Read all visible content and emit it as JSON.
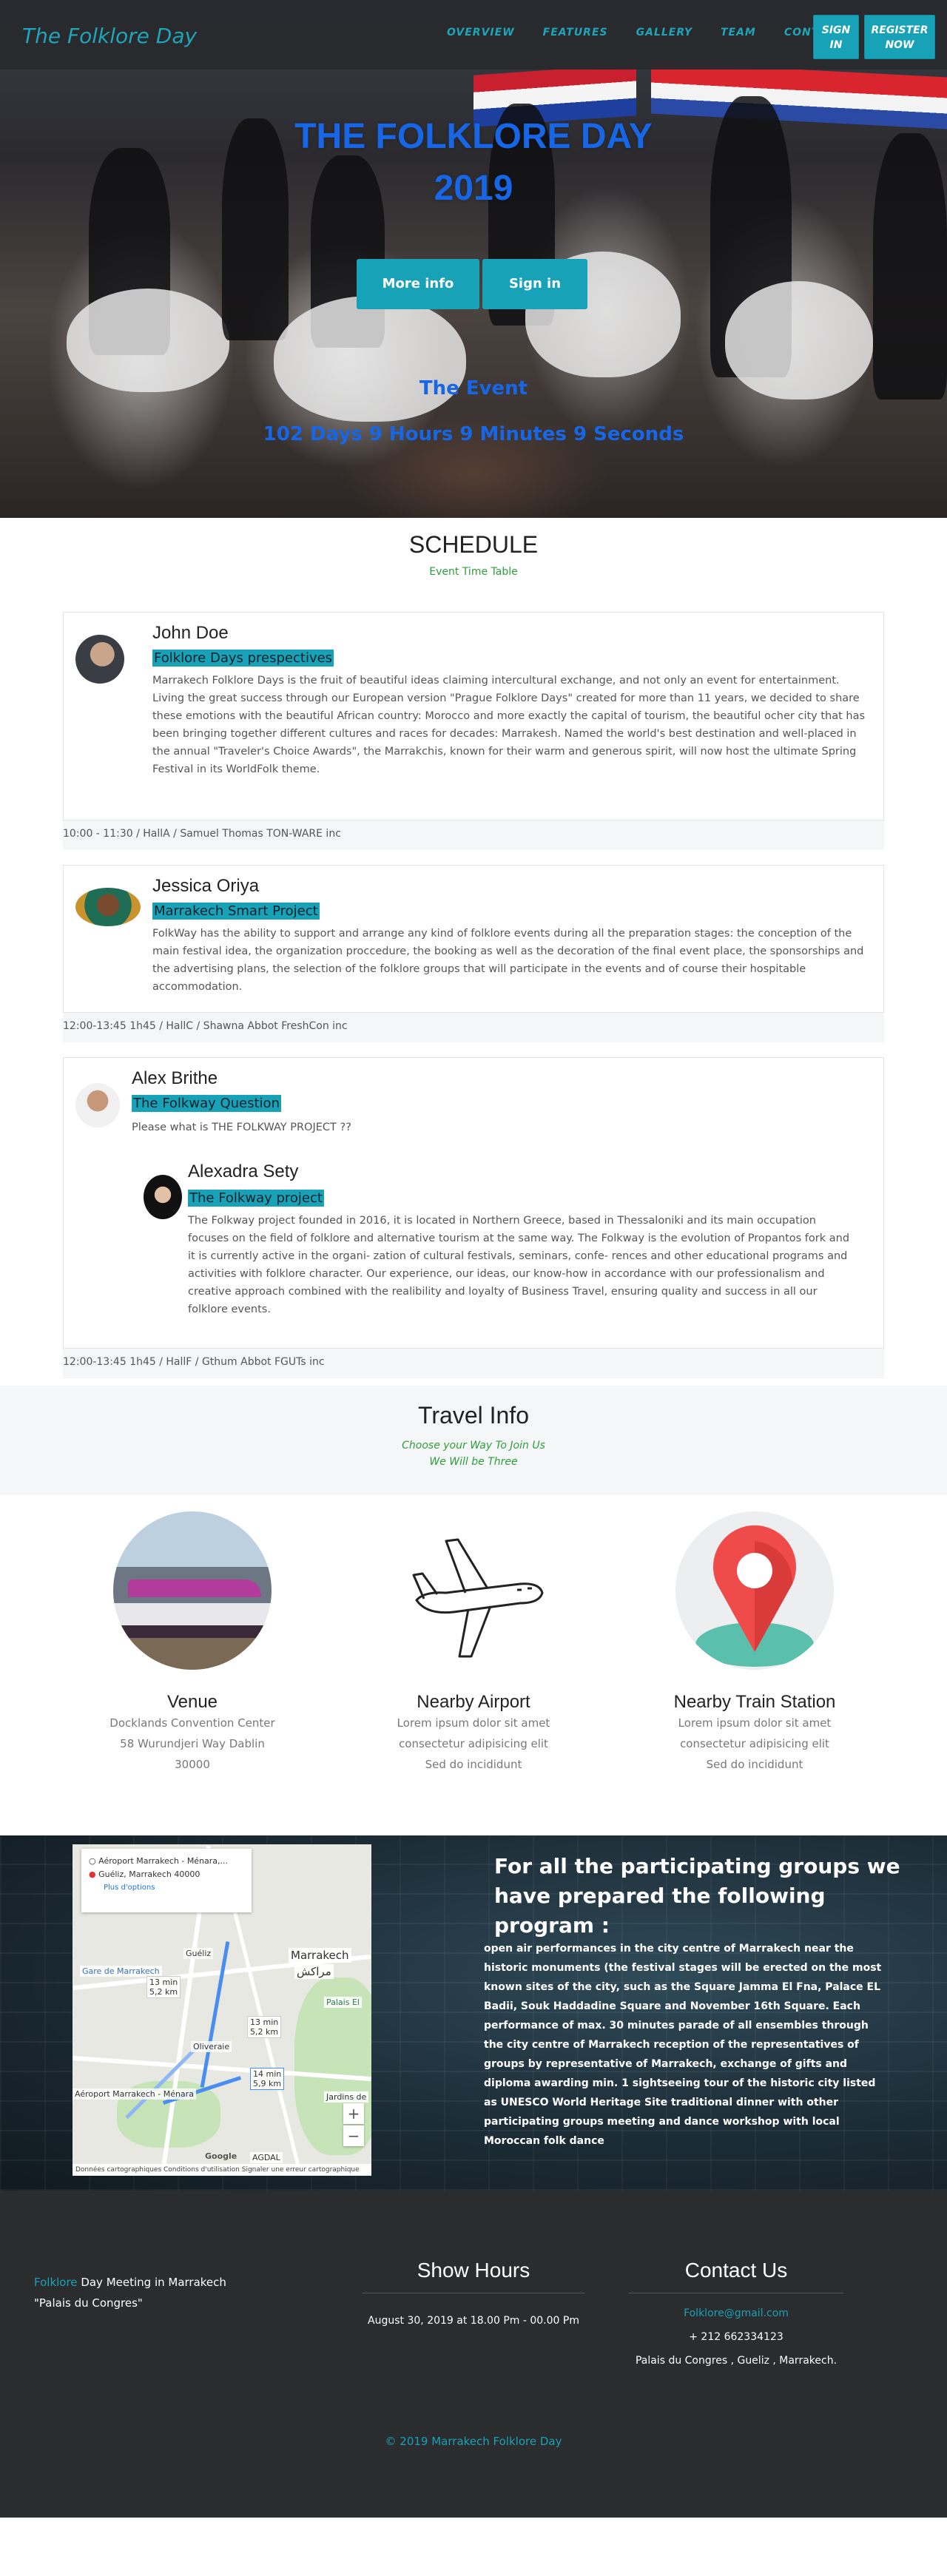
{
  "nav": {
    "brand": "The Folklore Day",
    "links": [
      "OVERVIEW",
      "FEATURES",
      "GALLERY",
      "TEAM",
      "CONTACT"
    ],
    "sign_in": "SIGN IN",
    "register": "REGISTER NOW"
  },
  "hero": {
    "title_line1": "THE FOLKLORE DAY",
    "title_line2": "2019",
    "more_info": "More info",
    "sign_in": "Sign in",
    "event_label": "The Event",
    "countdown": "102 Days 9 Hours 9 Minutes 9 Seconds"
  },
  "schedule": {
    "title": "SCHEDULE",
    "subtitle": "Event Time Table",
    "items": [
      {
        "name": "John Doe",
        "topic": "Folklore Days prespectives",
        "text": "Marrakech Folklore Days is the fruit of beautiful ideas claiming intercultural exchange, and not only an event for entertainment. Living the great success through our European version \"Prague Folklore Days\" created for more than 11 years, we decided to share these emotions with the beautiful African country: Morocco and more exactly the capital of tourism, the beautiful ocher city that has been bringing together different cultures and races for decades: Marrakesh. Named the world's best destination and well-placed in the annual \"Traveler's Choice Awards\", the Marrakchis, known for their warm and generous spirit, will now host the ultimate Spring Festival in its WorldFolk theme.",
        "footer": "10:00 - 11:30 / HallA / Samuel Thomas TON-WARE inc"
      },
      {
        "name": "Jessica Oriya",
        "topic": "Marrakech Smart Project",
        "text": "FolkWay has the ability to support and arrange any kind of folklore events during all the preparation stages: the conception of the main festival idea, the organization proccedure, the booking as well as the decoration of the final event place, the sponsorships and the advertising plans, the selection of the folklore groups that will participate in the events and of course their hospitable accommodation.",
        "footer": "12:00-13:45 1h45 / HallC / Shawna Abbot FreshCon inc"
      },
      {
        "name": "Alex Brithe",
        "topic": "The Folkway Question",
        "text": "Please what is THE FOLKWAY PROJECT ??",
        "reply": {
          "name": "Alexadra Sety",
          "topic": "The Folkway project",
          "text": "The Folkway project founded in 2016, it is located in Northern Greece, based in Thessaloniki and its main occupation focuses on the field of folklore and alternative tourism at the same way. The Folkway is the evolution of Propantos fork and it is currently active in the organi- zation of cultural festivals, seminars, confe- rences and other educational programs and activities with folklore character. Our experience, our ideas, our know-how in accordance with our professionalism and creative approach combined with the realibility and loyalty of Business Travel, ensuring quality and success in all our folklore events."
        },
        "footer": "12:00-13:45 1h45 / HallF / Gthum Abbot FGUTs inc"
      }
    ]
  },
  "travel": {
    "title": "Travel Info",
    "line1": "Choose your Way To Join Us",
    "line2": "We Will be Three",
    "cols": [
      {
        "title": "Venue",
        "lines": [
          "Docklands Convention Center",
          "58 Wurundjeri Way Dablin",
          "30000"
        ]
      },
      {
        "title": "Nearby Airport",
        "lines": [
          "Lorem ipsum dolor sit amet",
          "consectetur adipisicing elit",
          "Sed do incididunt"
        ]
      },
      {
        "title": "Nearby Train Station",
        "lines": [
          "Lorem ipsum dolor sit amet",
          "consectetur adipisicing elit",
          "Sed do incididunt"
        ]
      }
    ]
  },
  "map": {
    "from": "Aéroport Marrakech - Ménara,...",
    "to": "Guéliz, Marrakech 40000",
    "options": "Plus d'options",
    "label_gueliz": "Guéliz",
    "label_gare": "Gare de Marrakech",
    "label_marrakech": "Marrakech",
    "label_arabic": "مراكش",
    "label_palais": "Palais El",
    "label_olive": "Oliveraie",
    "label_airport": "Aéroport Marrakech - Ménara",
    "label_agdal": "AGDAL",
    "label_jardins": "Jardins de",
    "time1": "13 min",
    "dist1": "5,2 km",
    "time2": "13 min",
    "dist2": "5,2 km",
    "time3": "14 min",
    "dist3": "5,9 km",
    "attribution": "Données cartographiques   Conditions d'utilisation   Signaler une erreur cartographique",
    "zoom_in": "+",
    "zoom_out": "−",
    "google": "Google"
  },
  "program": {
    "title": "For all the participating groups we have prepared the following program :",
    "text": "open air performances in the city centre of Marrakech near the historic monuments (the festival stages will be erected on the most known sites of the city, such as the Square Jamma El Fna, Palace EL Badii, Souk Haddadine Square and November 16th Square. Each performance of max. 30 minutes parade of all ensembles through the city centre of Marrakech reception of the representatives of groups by representative of Marrakech, exchange of gifts and diploma awarding min. 1 sightseeing tour of the historic city listed as UNESCO World Heritage Site traditional dinner with other participating groups meeting and dance workshop with local Moroccan folk dance"
  },
  "footer": {
    "left_accent": "Folklore",
    "left_rest": " Day Meeting in Marrakech",
    "left_line2": "\"Palais du Congres\"",
    "show_title": "Show Hours",
    "show_text": "August 30, 2019 at 18.00 Pm - 00.00 Pm",
    "contact_title": "Contact Us",
    "email": "Folklore@gmail.com",
    "phone": "+ 212 662334123",
    "address": "Palais du Congres , Gueliz , Marrakech.",
    "copyright": "© 2019 Marrakech Folklore Day"
  },
  "colors": {
    "accent": "#17a2b8",
    "hero_text": "#1666e6",
    "green": "#2e9e3b",
    "footer_bg": "#2b2c2e"
  }
}
